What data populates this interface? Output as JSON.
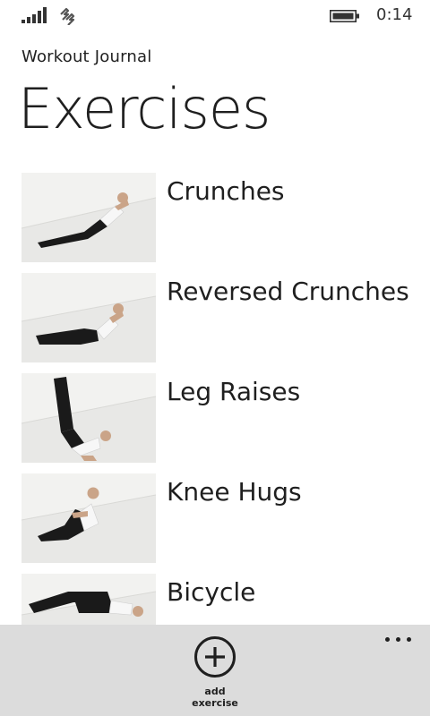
{
  "status_bar": {
    "time": "0:14",
    "signal_icon": "signal-strength-icon",
    "data_icon": "data-connection-icon",
    "battery_icon": "battery-icon"
  },
  "header": {
    "app_title": "Workout Journal",
    "page_title": "Exercises"
  },
  "exercises": [
    {
      "name": "Crunches",
      "image": "crunches-photo"
    },
    {
      "name": "Reversed Crunches",
      "image": "reversed-crunches-photo"
    },
    {
      "name": "Leg Raises",
      "image": "leg-raises-photo"
    },
    {
      "name": "Knee Hugs",
      "image": "knee-hugs-photo"
    },
    {
      "name": "Bicycle",
      "image": "bicycle-photo"
    }
  ],
  "app_bar": {
    "add_label_line1": "add",
    "add_label_line2": "exercise",
    "add_icon": "add-circle-icon",
    "more_icon": "ellipsis-icon"
  }
}
